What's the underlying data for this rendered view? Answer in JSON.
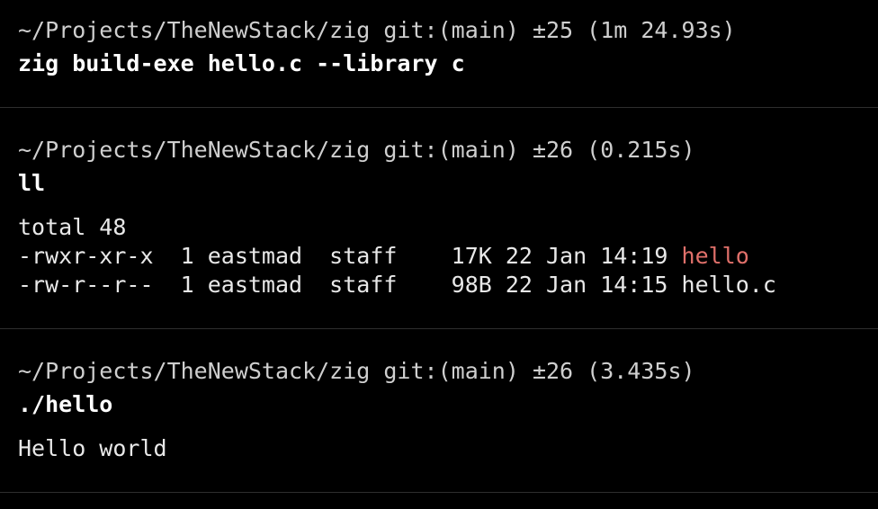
{
  "colors": {
    "background": "#000000",
    "text": "#e8e8e8",
    "executable": "#e0706a",
    "divider": "#2e2e2e"
  },
  "blocks": [
    {
      "prompt": "~/Projects/TheNewStack/zig git:(main) ±25 (1m 24.93s)",
      "command": "zig build-exe hello.c --library c",
      "output": []
    },
    {
      "prompt": "~/Projects/TheNewStack/zig git:(main) ±26 (0.215s)",
      "command": "ll",
      "output": [
        "total 48",
        "-rwxr-xr-x  1 eastmad  staff    17K 22 Jan 14:19 ",
        "-rw-r--r--  1 eastmad  staff    98B 22 Jan 14:15 hello.c"
      ],
      "executable_name": "hello"
    },
    {
      "prompt": "~/Projects/TheNewStack/zig git:(main) ±26 (3.435s)",
      "command": "./hello",
      "output": [
        "Hello world"
      ]
    }
  ]
}
